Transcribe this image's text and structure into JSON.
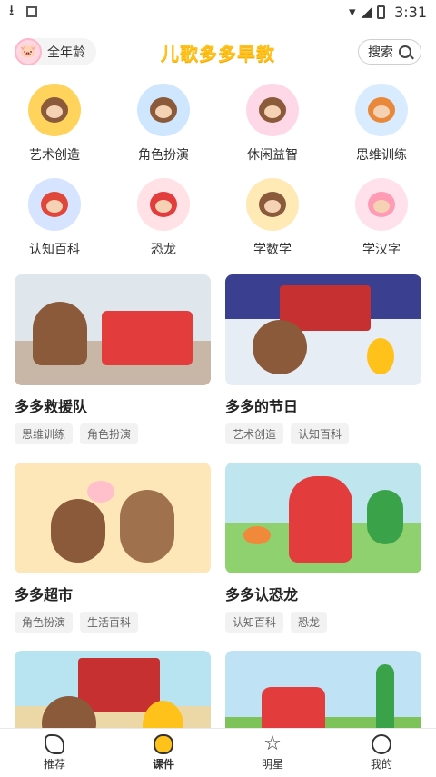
{
  "status": {
    "time": "3:31"
  },
  "header": {
    "age_label": "全年龄",
    "brand": "儿歌多多早教",
    "search_label": "搜索"
  },
  "categories": [
    {
      "label": "艺术创造",
      "bg": "#ffd35c"
    },
    {
      "label": "角色扮演",
      "bg": "#cfe6ff"
    },
    {
      "label": "休闲益智",
      "bg": "#ffd8e8"
    },
    {
      "label": "思维训练",
      "bg": "#d9ecff"
    },
    {
      "label": "认知百科",
      "bg": "#d7e4ff"
    },
    {
      "label": "恐龙",
      "bg": "#ffe1e6"
    },
    {
      "label": "学数学",
      "bg": "#ffe9b5"
    },
    {
      "label": "学汉字",
      "bg": "#ffe1ec"
    }
  ],
  "cards": [
    {
      "title": "多多救援队",
      "tags": [
        "思维训练",
        "角色扮演"
      ],
      "bg": "#dfe6ec"
    },
    {
      "title": "多多的节日",
      "tags": [
        "艺术创造",
        "认知百科"
      ],
      "bg": "#3b3f8f"
    },
    {
      "title": "多多超市",
      "tags": [
        "角色扮演",
        "生活百科"
      ],
      "bg": "#fde6b8"
    },
    {
      "title": "多多认恐龙",
      "tags": [
        "认知百科",
        "恐龙"
      ],
      "bg": "#bfe6ef"
    },
    {
      "title": "",
      "tags": [],
      "bg": "#b8e3f1"
    },
    {
      "title": "",
      "tags": [],
      "bg": "#bfe3f5"
    }
  ],
  "nav": [
    {
      "label": "推荐",
      "active": false
    },
    {
      "label": "课件",
      "active": true
    },
    {
      "label": "明星",
      "active": false
    },
    {
      "label": "我的",
      "active": false
    }
  ]
}
